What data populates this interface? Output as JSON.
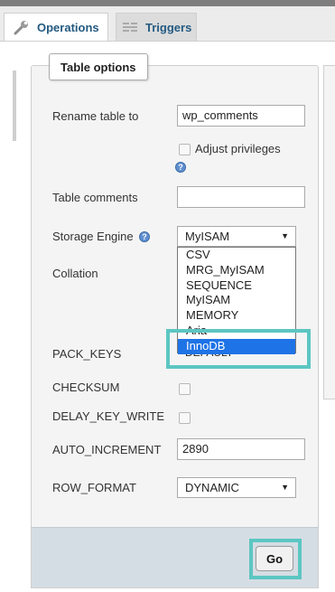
{
  "tabs": [
    {
      "label": "Operations",
      "icon": "wrench-icon"
    },
    {
      "label": "Triggers",
      "icon": "triggers-icon"
    }
  ],
  "fieldset": {
    "legend": "Table options"
  },
  "form": {
    "rename_label": "Rename table to",
    "rename_value": "wp_comments",
    "adjust_privileges_label": "Adjust privileges",
    "table_comments_label": "Table comments",
    "table_comments_value": "",
    "storage_engine_label": "Storage Engine",
    "storage_engine_value": "MyISAM",
    "storage_engine_options": [
      "CSV",
      "MRG_MyISAM",
      "SEQUENCE",
      "MyISAM",
      "MEMORY",
      "Aria",
      "InnoDB"
    ],
    "storage_engine_highlighted": "InnoDB",
    "collation_label": "Collation",
    "pack_keys_label": "PACK_KEYS",
    "pack_keys_value": "DEFAULT",
    "checksum_label": "CHECKSUM",
    "delay_key_write_label": "DELAY_KEY_WRITE",
    "auto_increment_label": "AUTO_INCREMENT",
    "auto_increment_value": "2890",
    "row_format_label": "ROW_FORMAT",
    "row_format_value": "DYNAMIC"
  },
  "footer": {
    "go_label": "Go"
  },
  "colors": {
    "highlight": "#5cc6c2",
    "selected_option": "#1e73e6",
    "link": "#235a81"
  }
}
